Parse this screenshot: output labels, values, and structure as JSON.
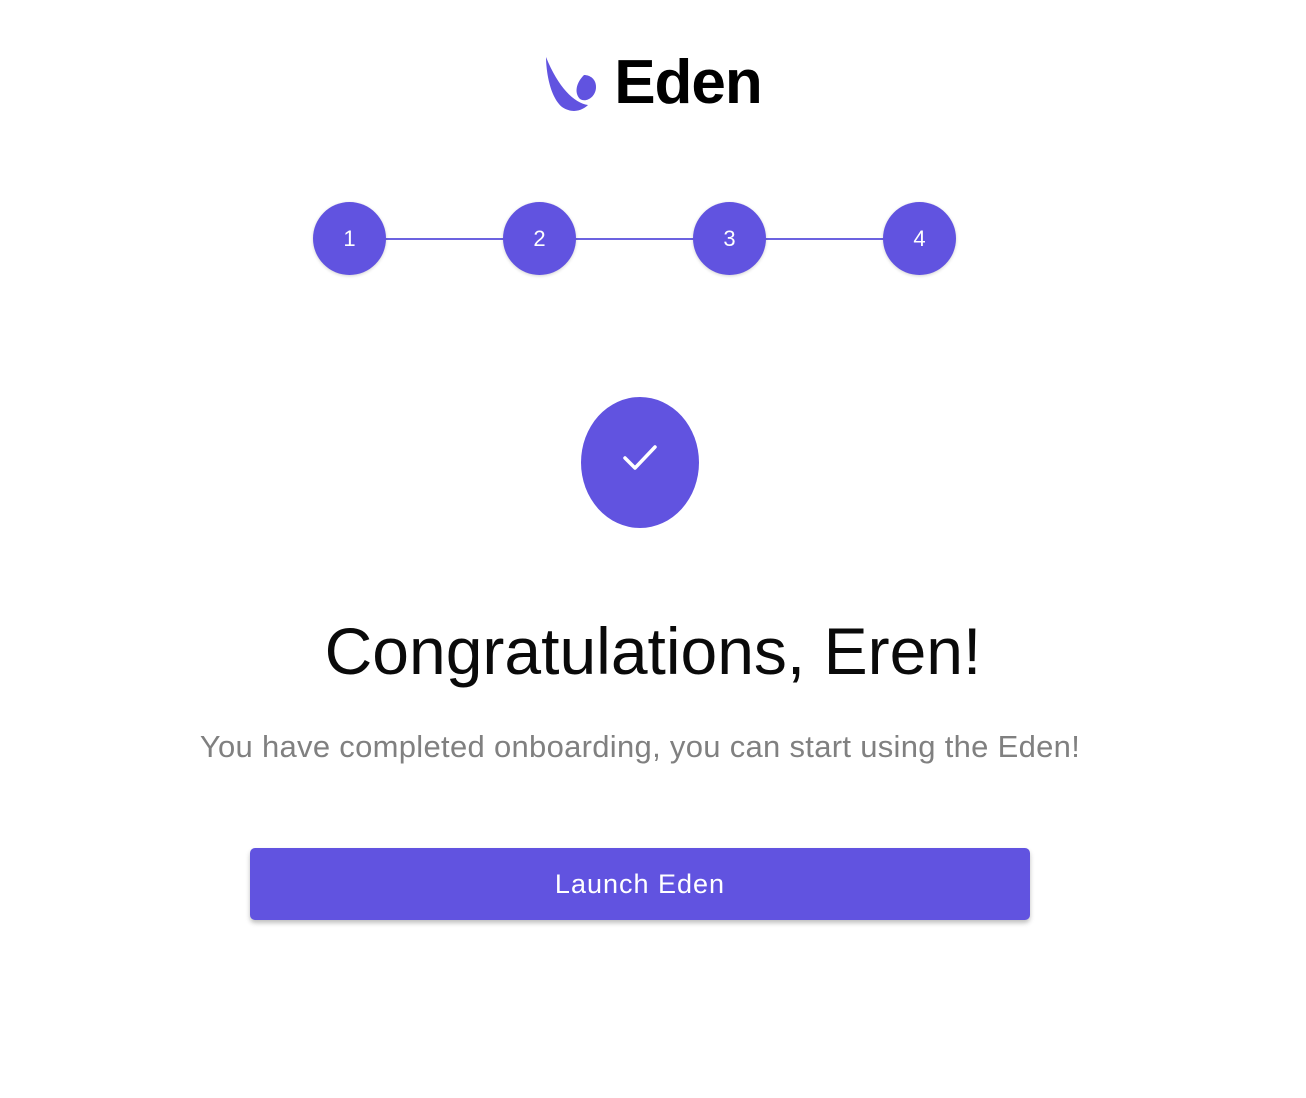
{
  "brand": {
    "name": "Eden",
    "logo_icon": "leaf-drop-icon",
    "accent_color": "#6153e0"
  },
  "stepper": {
    "steps": [
      "1",
      "2",
      "3",
      "4"
    ],
    "completed": 4
  },
  "success": {
    "icon": "check-icon",
    "headline": "Congratulations, Eren!",
    "subtitle": "You have completed onboarding, you can start using the Eden!"
  },
  "actions": {
    "launch_label": "Launch Eden"
  }
}
